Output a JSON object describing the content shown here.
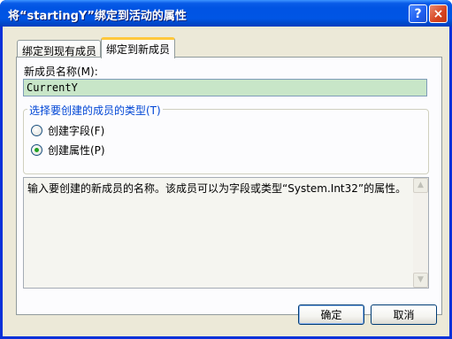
{
  "window": {
    "title": "将“startingY”绑定到活动的属性",
    "help_label": "?",
    "close_label": "×"
  },
  "tabs": [
    {
      "label": "绑定到现有成员",
      "selected": false
    },
    {
      "label": "绑定到新成员",
      "selected": true
    }
  ],
  "form": {
    "name_label": "新成员名称(M):",
    "name_value": "CurrentY",
    "group_title": "选择要创建的成员的类型(T)",
    "options": [
      {
        "label": "创建字段(F)",
        "checked": false
      },
      {
        "label": "创建属性(P)",
        "checked": true
      }
    ],
    "description": "输入要创建的新成员的名称。该成员可以为字段或类型“System.Int32”的属性。"
  },
  "buttons": {
    "ok_label": "确定",
    "cancel_label": "取消"
  },
  "colors": {
    "title_bar": "#0054e3",
    "name_input_bg": "#c8e6c8",
    "group_title": "#0046d5",
    "radio_dot": "#21a121"
  },
  "icons": {
    "scroll_up": "scroll-up-arrow-icon",
    "scroll_down": "scroll-down-arrow-icon"
  }
}
